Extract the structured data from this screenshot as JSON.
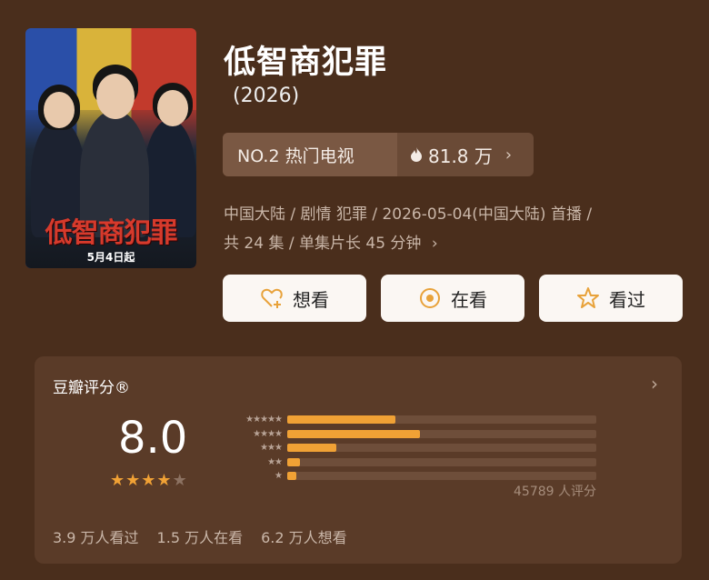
{
  "poster": {
    "title_art": "低智商犯罪",
    "release_note": "5月4日起"
  },
  "title": "低智商犯罪",
  "year": "(2026)",
  "ranking": {
    "label": "NO.2 热门电视",
    "heat": "81.8 万"
  },
  "meta": {
    "line1": "中国大陆 / 剧情 犯罪 / 2026-05-04(中国大陆) 首播 /",
    "line2": "共 24 集 / 单集片长 45 分钟"
  },
  "actions": [
    {
      "label": "想看",
      "icon": "heart-plus-icon"
    },
    {
      "label": "在看",
      "icon": "target-icon"
    },
    {
      "label": "看过",
      "icon": "star-outline-icon"
    }
  ],
  "rating": {
    "heading": "豆瓣评分®",
    "score": "8.0",
    "stars_filled": 4,
    "stars_total": 5,
    "distribution": [
      {
        "stars": 5,
        "fraction": 0.35
      },
      {
        "stars": 4,
        "fraction": 0.43
      },
      {
        "stars": 3,
        "fraction": 0.16
      },
      {
        "stars": 2,
        "fraction": 0.04
      },
      {
        "stars": 1,
        "fraction": 0.03
      }
    ],
    "count_text": "45789 人评分"
  },
  "stats": {
    "watched": "3.9 万人看过",
    "watching": "1.5 万人在看",
    "want": "6.2 万人想看"
  },
  "colors": {
    "background": "#4a2e1c",
    "accent": "#f0a135",
    "card": "#5a3b28"
  }
}
